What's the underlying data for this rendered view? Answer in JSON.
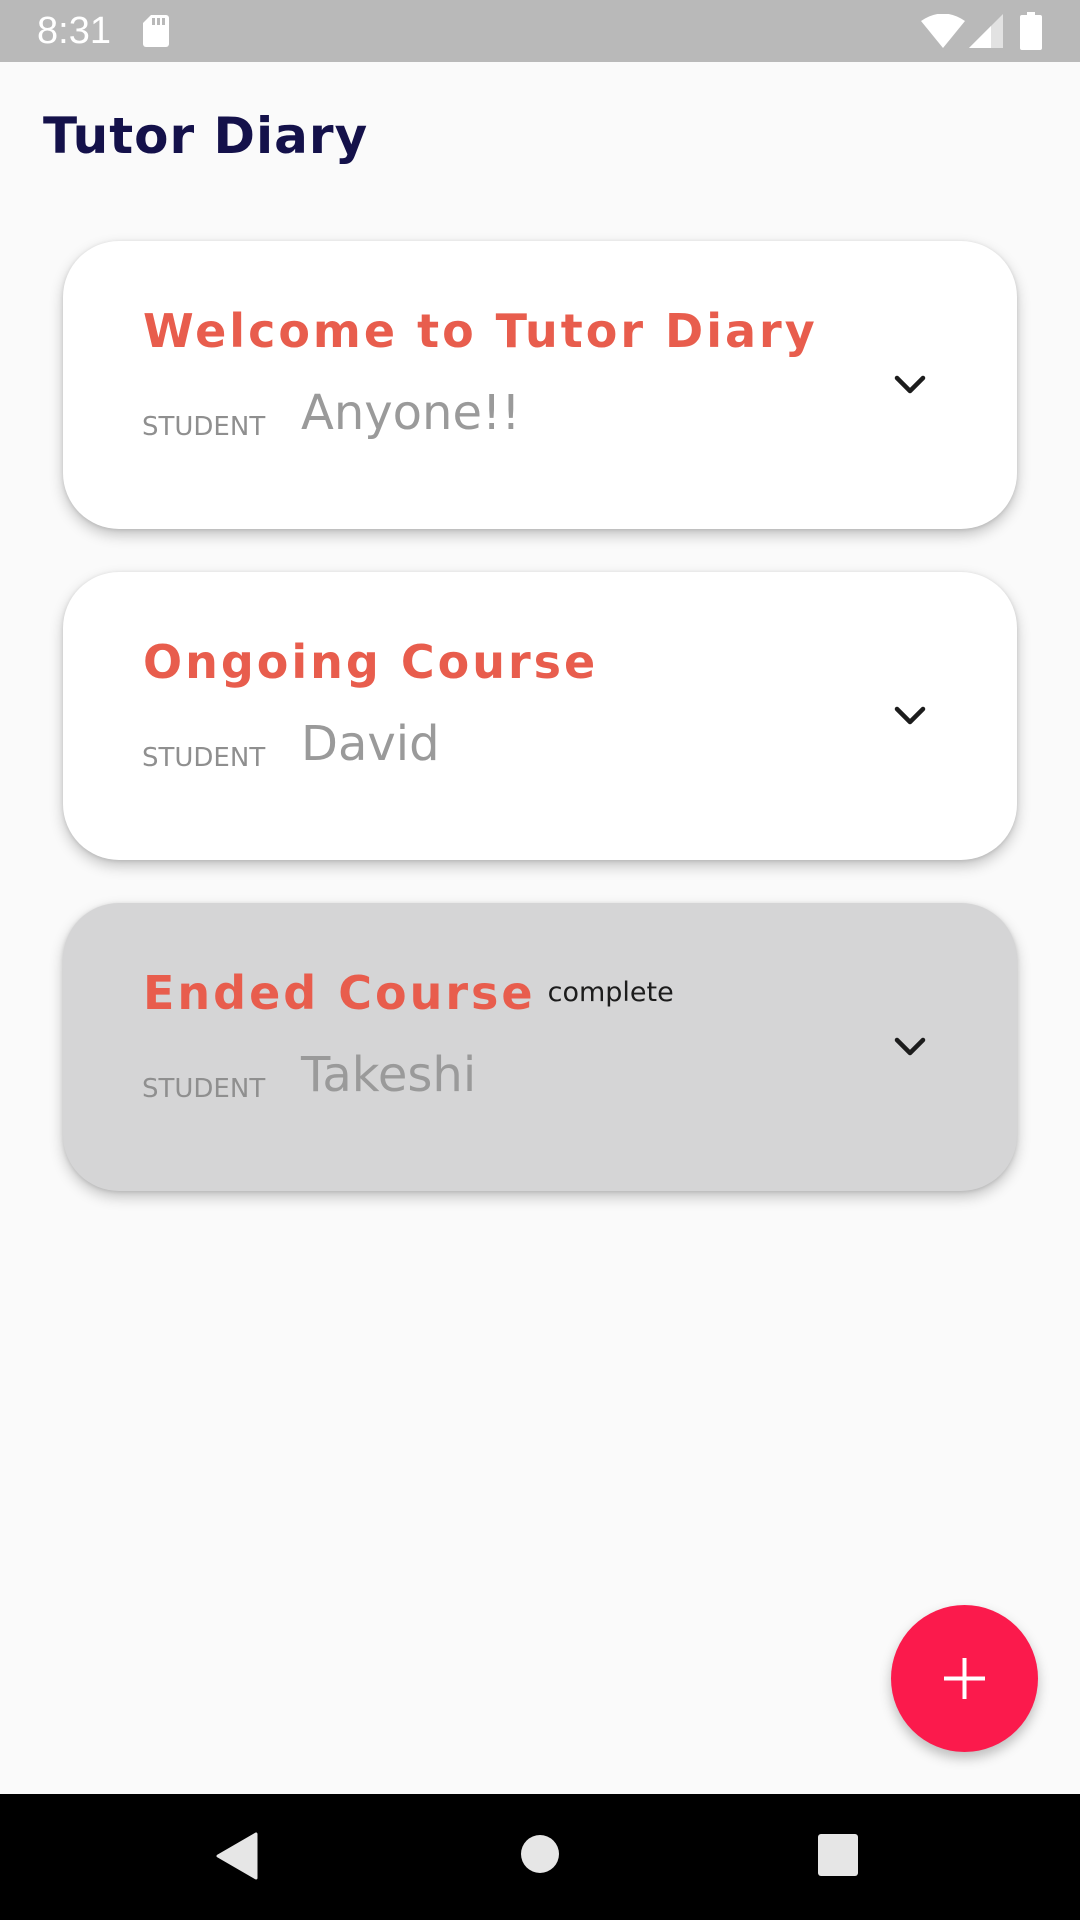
{
  "status_bar": {
    "time": "8:31",
    "icons": [
      "sd-card-icon",
      "wifi-icon",
      "signal-icon",
      "battery-icon"
    ]
  },
  "app": {
    "title": "Tutor Diary"
  },
  "courses": [
    {
      "title": "Welcome to Tutor Diary",
      "student_label": "STUDENT",
      "student_name": "Anyone!!",
      "status": "",
      "icon": "chevron-down-icon"
    },
    {
      "title": "Ongoing Course",
      "student_label": "STUDENT",
      "student_name": "David",
      "status": "",
      "icon": "chevron-down-icon"
    },
    {
      "title": "Ended Course",
      "student_label": "STUDENT",
      "student_name": "Takeshi",
      "status": "complete",
      "icon": "chevron-down-icon"
    }
  ],
  "fab": {
    "icon": "plus-icon"
  },
  "nav_bar": {
    "icons": [
      "back-icon",
      "home-icon",
      "recents-icon"
    ]
  },
  "colors": {
    "status_bar": "#b9b9b9",
    "background": "#fafafa",
    "title": "#14114a",
    "course_title": "#e85d4d",
    "ended_card": "#d5d5d6",
    "fab": "#fb1a4c",
    "nav_bar": "#000000"
  }
}
